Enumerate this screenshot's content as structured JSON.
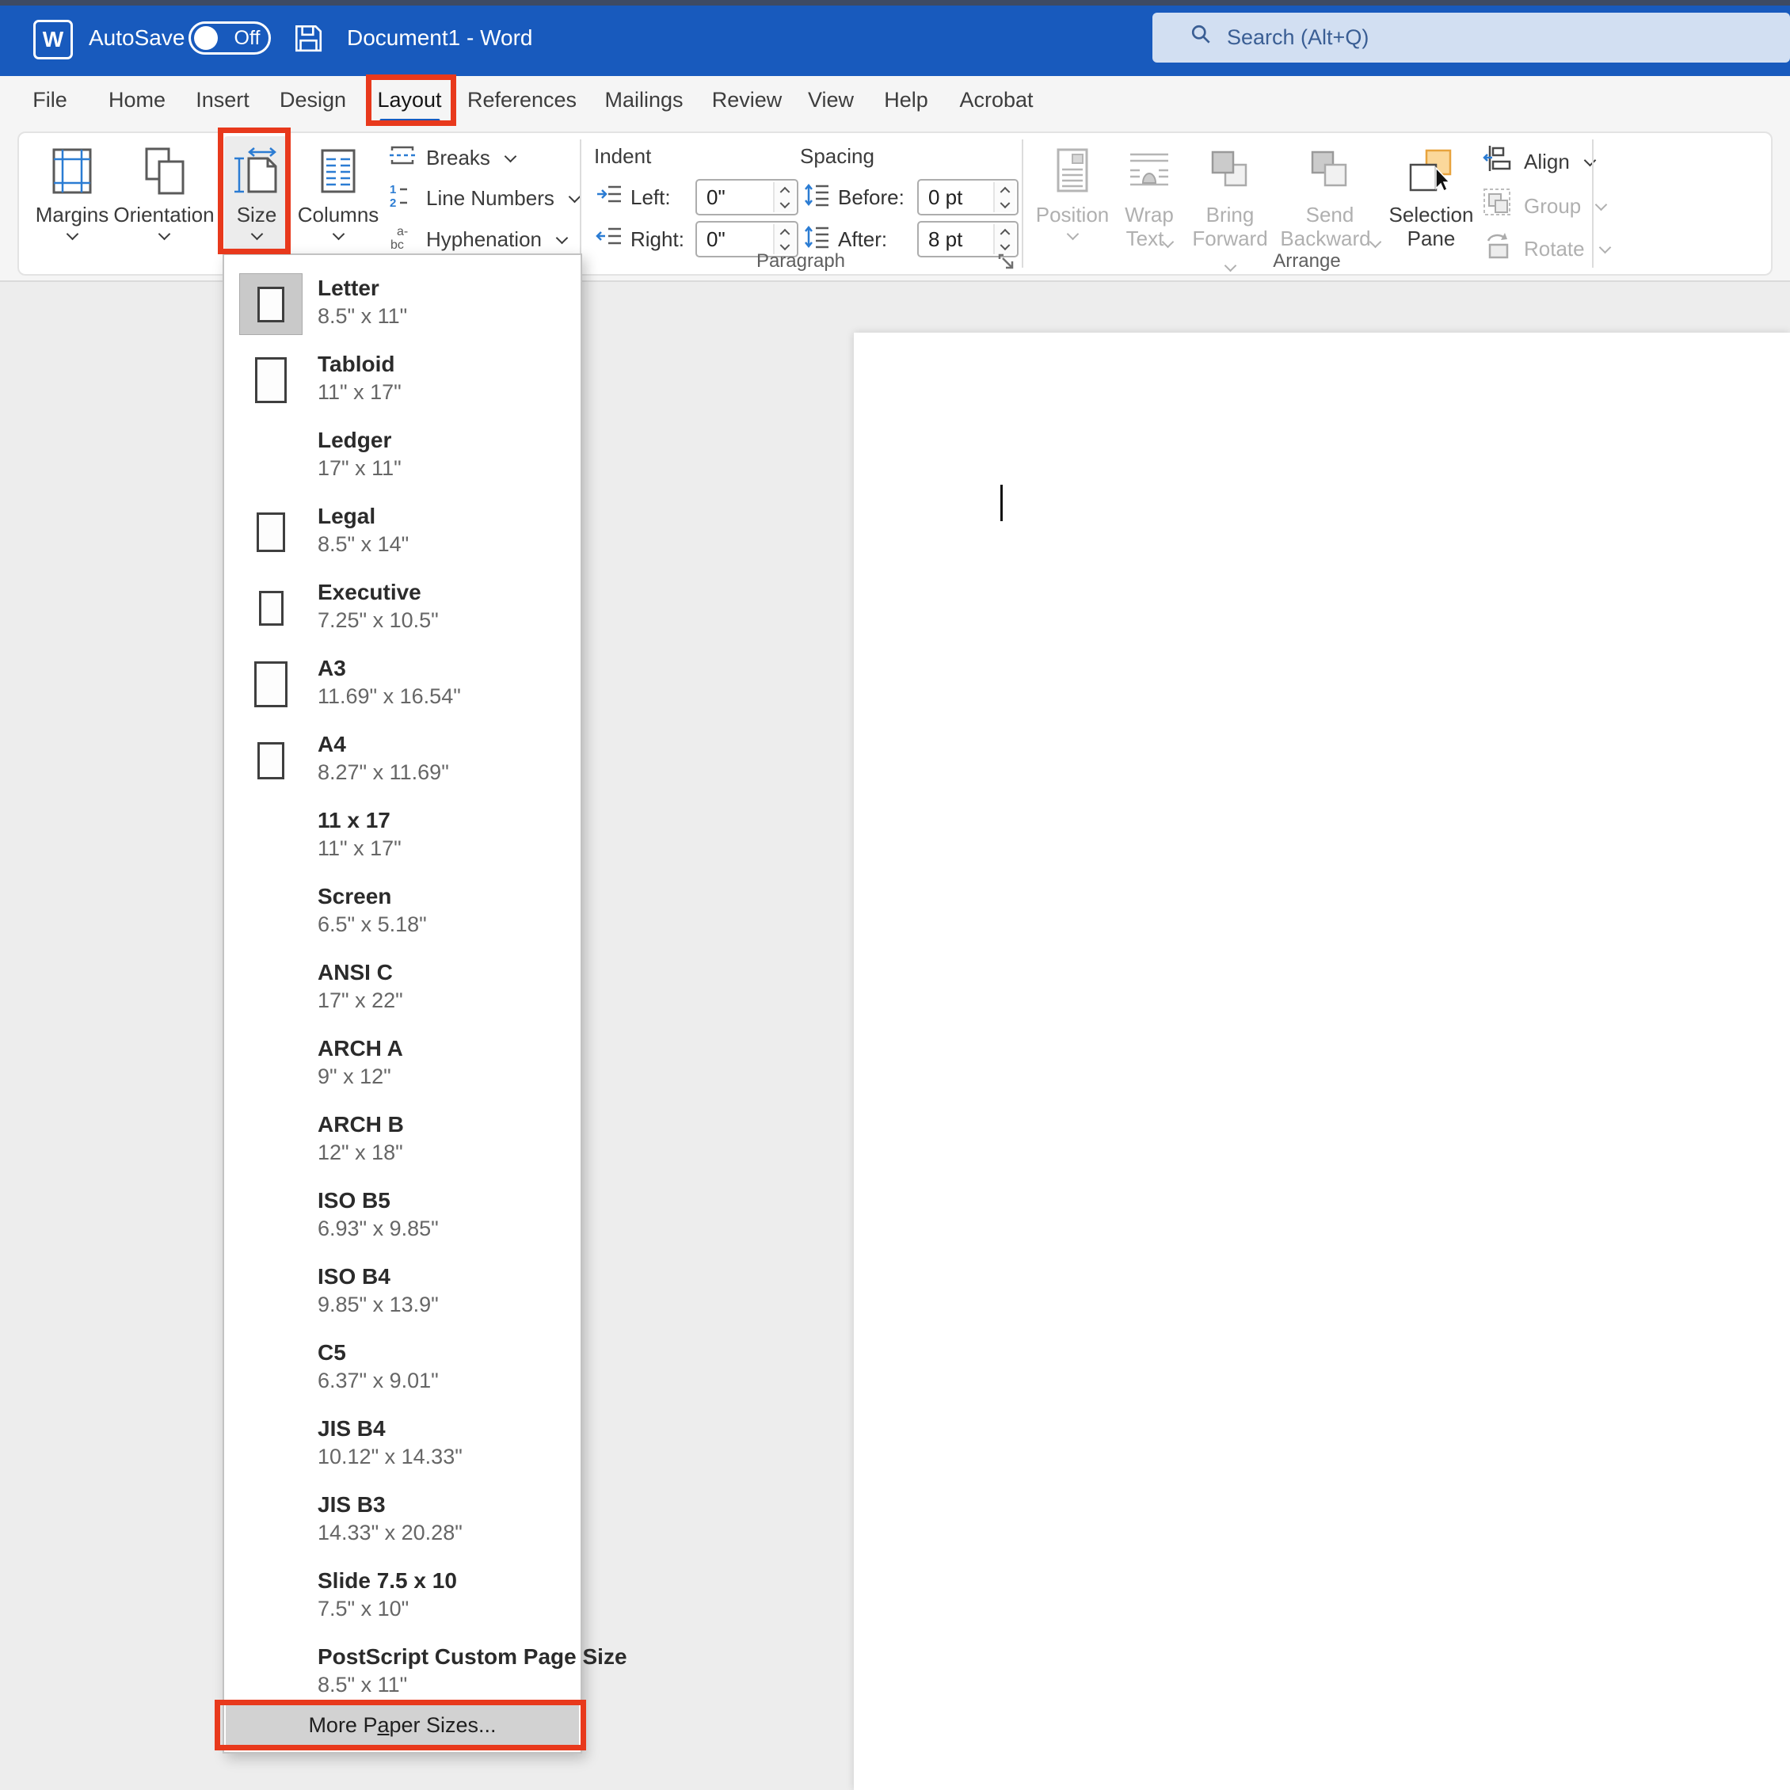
{
  "titlebar": {
    "app_icon_letter": "W",
    "autosave_label": "AutoSave",
    "autosave_state": "Off",
    "document_title": "Document1 - Word",
    "search_placeholder": "Search (Alt+Q)"
  },
  "colors": {
    "titlebar_blue": "#185abd",
    "annotation_red": "#e8391c",
    "icon_accent_blue": "#2b7cd3",
    "selected_tab_underline": "#185abd"
  },
  "ribbon": {
    "tabs": [
      {
        "label": "File",
        "selected": false
      },
      {
        "label": "Home",
        "selected": false
      },
      {
        "label": "Insert",
        "selected": false
      },
      {
        "label": "Design",
        "selected": false
      },
      {
        "label": "Layout",
        "selected": true,
        "annotated": true
      },
      {
        "label": "References",
        "selected": false
      },
      {
        "label": "Mailings",
        "selected": false
      },
      {
        "label": "Review",
        "selected": false
      },
      {
        "label": "View",
        "selected": false
      },
      {
        "label": "Help",
        "selected": false
      },
      {
        "label": "Acrobat",
        "selected": false
      }
    ],
    "page_setup": {
      "big_buttons": [
        {
          "label": "Margins",
          "icon": "margins-icon"
        },
        {
          "label": "Orientation",
          "icon": "orientation-icon"
        },
        {
          "label": "Size",
          "icon": "size-icon",
          "annotated": true
        },
        {
          "label": "Columns",
          "icon": "columns-icon"
        }
      ],
      "small_buttons": [
        {
          "label": "Breaks",
          "icon": "breaks-icon"
        },
        {
          "label": "Line Numbers",
          "icon": "line-numbers-icon"
        },
        {
          "label": "Hyphenation",
          "icon": "hyphenation-icon"
        }
      ]
    },
    "paragraph": {
      "group_label": "Paragraph",
      "indent_label": "Indent",
      "spacing_label": "Spacing",
      "fields": [
        {
          "label": "Left:",
          "value": "0\"",
          "icon": "indent-left-icon"
        },
        {
          "label": "Right:",
          "value": "0\"",
          "icon": "indent-right-icon"
        },
        {
          "label": "Before:",
          "value": "0 pt",
          "icon": "spacing-before-icon"
        },
        {
          "label": "After:",
          "value": "8 pt",
          "icon": "spacing-after-icon"
        }
      ]
    },
    "arrange": {
      "group_label": "Arrange",
      "buttons": [
        {
          "label1": "Position",
          "label2": "",
          "icon": "position-icon",
          "disabled": true,
          "chevron": true
        },
        {
          "label1": "Wrap",
          "label2": "Text",
          "icon": "wrap-text-icon",
          "disabled": true,
          "chevron": true
        },
        {
          "label1": "Bring",
          "label2": "Forward",
          "icon": "bring-forward-icon",
          "disabled": true,
          "chevron": true
        },
        {
          "label1": "Send",
          "label2": "Backward",
          "icon": "send-backward-icon",
          "disabled": true,
          "chevron": true
        },
        {
          "label1": "Selection",
          "label2": "Pane",
          "icon": "selection-pane-icon",
          "disabled": false,
          "chevron": false
        },
        {
          "label": "Align",
          "icon": "align-icon",
          "disabled": false,
          "chevron": true
        },
        {
          "label": "Group",
          "icon": "group-icon",
          "disabled": true,
          "chevron": true
        },
        {
          "label": "Rotate",
          "icon": "rotate-icon",
          "disabled": true,
          "chevron": true
        }
      ]
    }
  },
  "size_menu": {
    "items": [
      {
        "name": "Letter",
        "dims": "8.5\" x 11\"",
        "selected": true,
        "icon": {
          "w": 34,
          "h": 45
        }
      },
      {
        "name": "Tabloid",
        "dims": "11\" x 17\"",
        "icon": {
          "w": 40,
          "h": 58
        }
      },
      {
        "name": "Ledger",
        "dims": "17\" x 11\""
      },
      {
        "name": "Legal",
        "dims": "8.5\" x 14\"",
        "icon": {
          "w": 36,
          "h": 50
        }
      },
      {
        "name": "Executive",
        "dims": "7.25\" x 10.5\"",
        "icon": {
          "w": 31,
          "h": 44
        }
      },
      {
        "name": "A3",
        "dims": "11.69\" x 16.54\"",
        "icon": {
          "w": 42,
          "h": 58
        }
      },
      {
        "name": "A4",
        "dims": "8.27\" x 11.69\"",
        "icon": {
          "w": 34,
          "h": 47
        }
      },
      {
        "name": "11 x 17",
        "dims": "11\" x 17\""
      },
      {
        "name": "Screen",
        "dims": "6.5\" x 5.18\""
      },
      {
        "name": "ANSI C",
        "dims": "17\" x 22\""
      },
      {
        "name": "ARCH A",
        "dims": "9\" x 12\""
      },
      {
        "name": "ARCH B",
        "dims": "12\" x 18\""
      },
      {
        "name": "ISO B5",
        "dims": "6.93\" x 9.85\""
      },
      {
        "name": "ISO B4",
        "dims": "9.85\" x 13.9\""
      },
      {
        "name": "C5",
        "dims": "6.37\" x 9.01\""
      },
      {
        "name": "JIS B4",
        "dims": "10.12\" x 14.33\""
      },
      {
        "name": "JIS B3",
        "dims": "14.33\" x 20.28\""
      },
      {
        "name": "Slide 7.5 x 10",
        "dims": "7.5\" x 10\""
      },
      {
        "name": "PostScript Custom Page Size",
        "dims": "8.5\" x 11\""
      }
    ],
    "footer": {
      "part1": "More P",
      "part2": "a",
      "part3": "per Sizes..."
    }
  }
}
